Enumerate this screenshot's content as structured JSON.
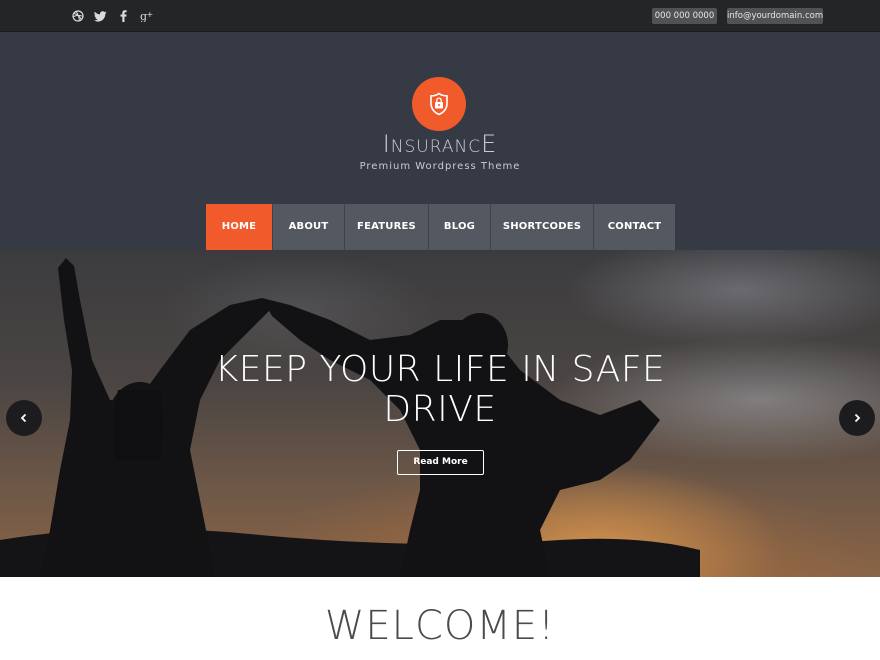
{
  "topbar": {
    "social": [
      {
        "icon": "dribbble-icon"
      },
      {
        "icon": "twitter-icon"
      },
      {
        "icon": "facebook-icon"
      },
      {
        "icon": "google-plus-icon"
      }
    ],
    "phone": "000 000 0000",
    "email": "info@yourdomain.com"
  },
  "header": {
    "logo_icon": "shield-lock-icon",
    "brand_first": "I",
    "brand_middle": "NSURANC",
    "brand_last": "E",
    "tagline": "Premium Wordpress Theme",
    "accent_color": "#f15a2b"
  },
  "nav": {
    "items": [
      {
        "label": "HOME",
        "active": true
      },
      {
        "label": "ABOUT"
      },
      {
        "label": "FEATURES"
      },
      {
        "label": "BLOG"
      },
      {
        "label": "SHORTCODES"
      },
      {
        "label": "CONTACT"
      }
    ]
  },
  "hero": {
    "title_line1": "KEEP YOUR LIFE IN SAFE",
    "title_line2": "DRIVE",
    "button": "Read More",
    "prev_icon": "chevron-left-icon",
    "next_icon": "chevron-right-icon"
  },
  "welcome": {
    "heading": "WELCOME!"
  }
}
